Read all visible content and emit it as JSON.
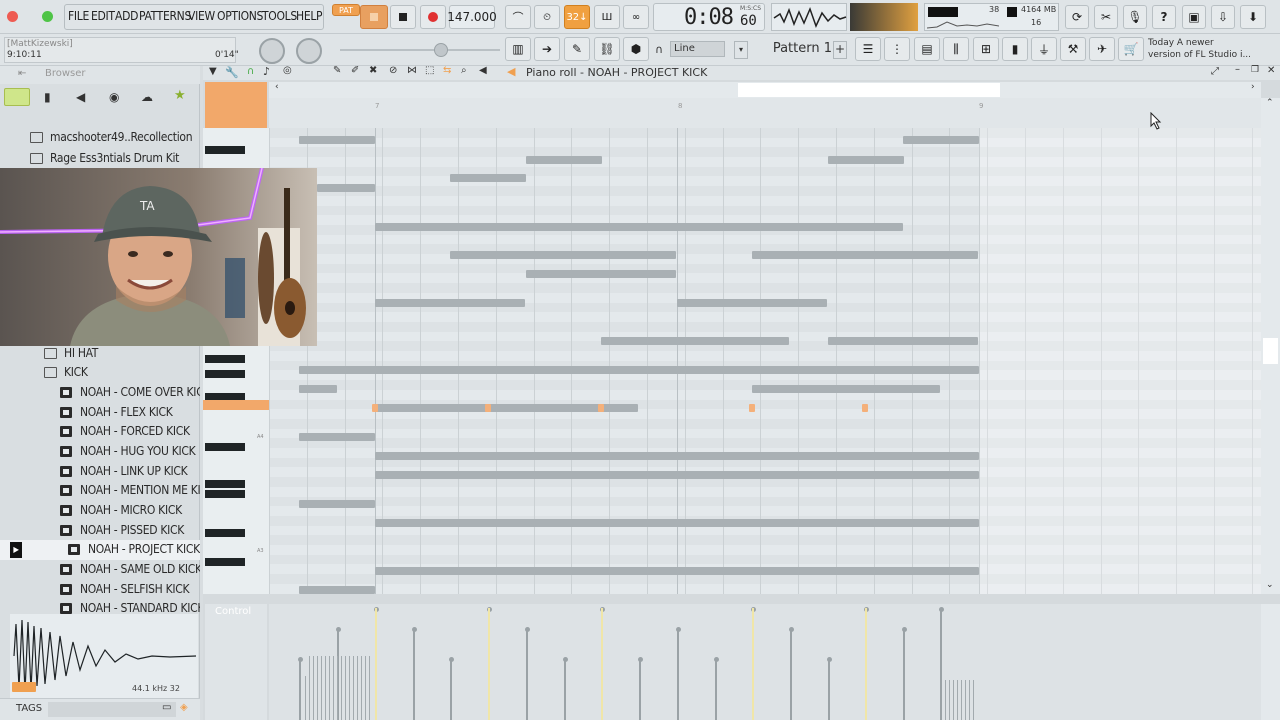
{
  "menu": {
    "items": [
      "FILE",
      "EDIT",
      "ADD",
      "PATTERNS",
      "VIEW",
      "OPTIONS",
      "TOOLS",
      "HELP"
    ]
  },
  "transport": {
    "pat_label": "PAT",
    "tempo": "147.000",
    "time": "0:08",
    "time_sub": "60",
    "time_label": "M:S:CS",
    "snap_label": "32↓"
  },
  "monitor": {
    "memory": "4164 MB",
    "cpu": "38",
    "polyphony": "16"
  },
  "hint": {
    "user": "[MattKizewski]",
    "time": "9:10:11",
    "position": "0'14\""
  },
  "toolbar2": {
    "snap_mode": "Line",
    "pattern": "Pattern 1",
    "news_line1": "Today  A newer",
    "news_line2": "version of FL Studio i..."
  },
  "browser": {
    "title": "Browser",
    "items": [
      {
        "label": "macshooter49..Recollection",
        "type": "folder"
      },
      {
        "label": "Rage Ess3ntials Drum Kit",
        "type": "folder"
      },
      {
        "label": "HI HAT",
        "type": "folder"
      },
      {
        "label": "KICK",
        "type": "folder"
      },
      {
        "label": "NOAH - COME OVER KICK",
        "type": "file"
      },
      {
        "label": "NOAH - FLEX KICK",
        "type": "file"
      },
      {
        "label": "NOAH - FORCED KICK",
        "type": "file"
      },
      {
        "label": "NOAH - HUG YOU KICK",
        "type": "file"
      },
      {
        "label": "NOAH - LINK UP KICK",
        "type": "file"
      },
      {
        "label": "NOAH - MENTION ME KICK",
        "type": "file"
      },
      {
        "label": "NOAH - MICRO KICK",
        "type": "file"
      },
      {
        "label": "NOAH - PISSED KICK",
        "type": "file"
      },
      {
        "label": "NOAH - PROJECT KICK",
        "type": "file",
        "selected": true
      },
      {
        "label": "NOAH - SAME OLD KICK",
        "type": "file"
      },
      {
        "label": "NOAH - SELFISH KICK",
        "type": "file"
      },
      {
        "label": "NOAH - STANDARD KICK",
        "type": "file"
      }
    ],
    "sample_info": "44.1 kHz 32",
    "tags_label": "TAGS"
  },
  "piano_roll": {
    "title": "Piano roll - NOAH - PROJECT KICK",
    "bar_numbers": [
      "7",
      "8",
      "9"
    ],
    "event_label": "Control",
    "key_labels": [
      "A4",
      "A3"
    ]
  },
  "colors": {
    "accent": "#f0a060",
    "note": "#a9b0b4",
    "bg": "#e4e9ec"
  }
}
